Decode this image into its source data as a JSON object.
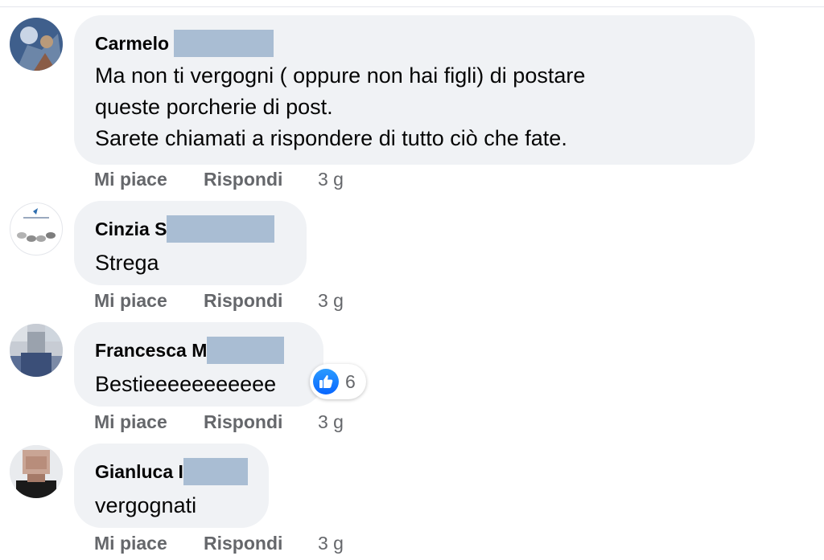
{
  "comments": [
    {
      "name": "Carmelo",
      "text_lines": [
        "Ma non ti vergogni ( oppure non hai figli) di postare",
        "queste porcherie di post.",
        "Sarete chiamati a rispondere di tutto ciò che fate."
      ],
      "like_label": "Mi piace",
      "reply_label": "Rispondi",
      "time": "3 g"
    },
    {
      "name": "Cinzia S",
      "name_tail": "",
      "text": "Strega",
      "like_label": "Mi piace",
      "reply_label": "Rispondi",
      "time": "3 g"
    },
    {
      "name": "Francesca M",
      "text": "Bestieeeeeeeeeee",
      "reaction": {
        "icon": "thumbs-up-icon",
        "count": "6",
        "color": "#0866ff"
      },
      "like_label": "Mi piace",
      "reply_label": "Rispondi",
      "time": "3 g"
    },
    {
      "name": "Gianluca I",
      "text": "vergognati",
      "like_label": "Mi piace",
      "reply_label": "Rispondi",
      "time": "3 g"
    }
  ],
  "colors": {
    "bubble_bg": "#f0f2f5",
    "secondary_text": "#65676b",
    "redaction": "#a9bdd3"
  }
}
